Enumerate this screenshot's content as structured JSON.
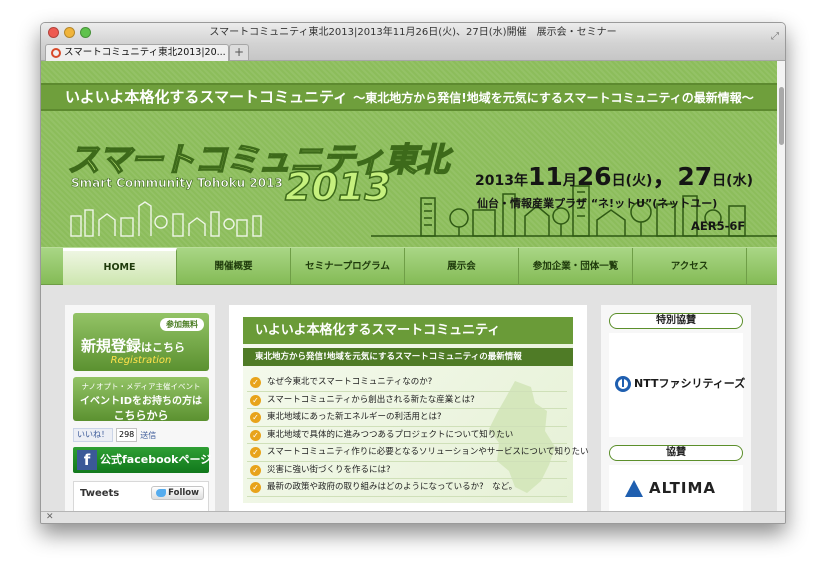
{
  "window": {
    "title": "スマートコミュニティ東北2013|2013年11月26日(火)、27日(水)開催　展示会・セミナー",
    "tab_label": "スマートコミュニティ東北2013|20...",
    "new_tab": "+"
  },
  "header": {
    "tagline": "いよいよ本格化するスマートコミュニティ",
    "tagline_sub": "～東北地方から発信!地域を元気にするスマートコミュニティの最新情報～",
    "logo_jp": "スマートコミュニティ東北",
    "logo_en": "Smart Community Tohoku 2013",
    "logo_year": "2013",
    "date": {
      "year": "2013",
      "year_unit": "年",
      "month": "11",
      "month_unit": "月",
      "day1": "26",
      "day1_suffix": "日(火)",
      "sep": "，",
      "day2": "27",
      "day2_suffix": "日(水)"
    },
    "venue": "仙台・情報産業プラザ “ネ!ットU”(ネットユー)",
    "room": "AER5-6F"
  },
  "nav": {
    "items": [
      {
        "label": "HOME"
      },
      {
        "label": "開催概要"
      },
      {
        "label": "セミナープログラム"
      },
      {
        "label": "展示会"
      },
      {
        "label": "参加企業・団体一覧"
      },
      {
        "label": "アクセス"
      }
    ]
  },
  "left": {
    "register_badge": "参加無料",
    "register_main": "新規登録",
    "register_main_suffix": "はこちら",
    "register_en": "Registration",
    "id_line1": "ナノオプト・メディア主催イベント",
    "id_line2": "イベントIDをお持ちの方は",
    "id_line3": "こちらから",
    "like_label": "いいね！",
    "like_count": "298",
    "send_label": "送信",
    "fb_label": "公式facebookページ",
    "fb_icon_letter": "f",
    "tweets_title": "Tweets",
    "follow_label": "Follow"
  },
  "feature": {
    "title": "いよいよ本格化するスマートコミュニティ",
    "subtitle": "東北地方から発信!地域を元気にするスマートコミュニティの最新情報",
    "items": [
      "なぜ今東北でスマートコミュニティなのか?",
      "スマートコミュニティから創出される新たな産業とは?",
      "東北地域にあった新エネルギーの利活用とは?",
      "東北地域で具体的に進みつつあるプロジェクトについて知りたい",
      "スマートコミュニティ作りに必要となるソリューションやサービスについて知りたい",
      "災害に強い街づくりを作るには?",
      "最新の政策や政府の取り組みはどのようになっているか?　など。"
    ]
  },
  "right": {
    "special_sponsor_label": "特別協賛",
    "special_sponsor_name": "NTTファシリティーズ",
    "sponsor_label": "協賛",
    "sponsor_name": "ALTIMA"
  },
  "colors": {
    "header_green": "#8cbd5b",
    "nav_green": "#84bb56",
    "accent_dark_green": "#4f7b26",
    "check_orange": "#e8a31a"
  }
}
